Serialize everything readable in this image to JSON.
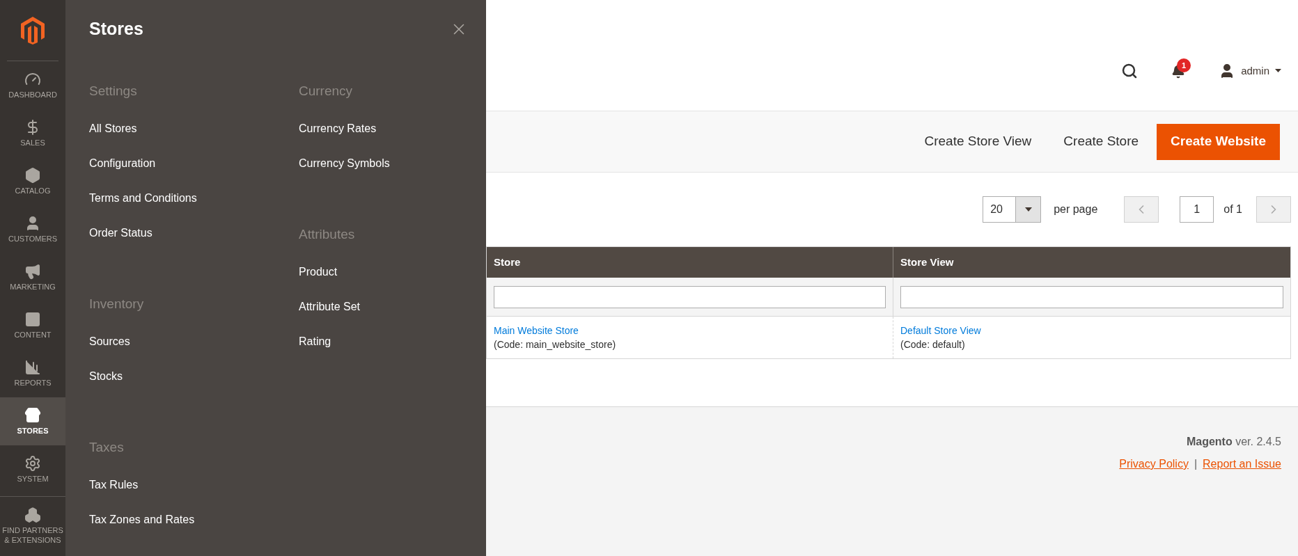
{
  "sidebar": {
    "items": [
      {
        "label": "DASHBOARD",
        "selected": false
      },
      {
        "label": "SALES",
        "selected": false
      },
      {
        "label": "CATALOG",
        "selected": false
      },
      {
        "label": "CUSTOMERS",
        "selected": false
      },
      {
        "label": "MARKETING",
        "selected": false
      },
      {
        "label": "CONTENT",
        "selected": false
      },
      {
        "label": "REPORTS",
        "selected": false
      },
      {
        "label": "STORES",
        "selected": true
      },
      {
        "label": "SYSTEM",
        "selected": false
      },
      {
        "label": "FIND PARTNERS & EXTENSIONS",
        "selected": false
      }
    ]
  },
  "flyout": {
    "title": "Stores",
    "columns": [
      [
        {
          "title": "Settings",
          "items": [
            "All Stores",
            "Configuration",
            "Terms and Conditions",
            "Order Status"
          ]
        },
        {
          "title": "Inventory",
          "items": [
            "Sources",
            "Stocks"
          ]
        },
        {
          "title": "Taxes",
          "items": [
            "Tax Rules",
            "Tax Zones and Rates"
          ]
        }
      ],
      [
        {
          "title": "Currency",
          "items": [
            "Currency Rates",
            "Currency Symbols"
          ]
        },
        {
          "title": "Attributes",
          "items": [
            "Product",
            "Attribute Set",
            "Rating"
          ]
        }
      ]
    ]
  },
  "header": {
    "notification_count": "1",
    "user": "admin"
  },
  "actions": [
    {
      "label": "Create Store View",
      "kind": "secondary"
    },
    {
      "label": "Create Store",
      "kind": "secondary"
    },
    {
      "label": "Create Website",
      "kind": "primary"
    }
  ],
  "pager": {
    "per_page": "20",
    "per_page_label": "per page",
    "page": "1",
    "of": "of 1"
  },
  "table": {
    "columns": [
      "Store",
      "Store View"
    ],
    "rows": [
      [
        {
          "link": "Main Website Store",
          "code": "(Code: main_website_store)"
        },
        {
          "link": "Default Store View",
          "code": "(Code: default)"
        }
      ]
    ]
  },
  "footer": {
    "brand": "Magento",
    "version": "ver. 2.4.5",
    "links": [
      "Privacy Policy",
      "Report an Issue"
    ],
    "separator": "|"
  }
}
